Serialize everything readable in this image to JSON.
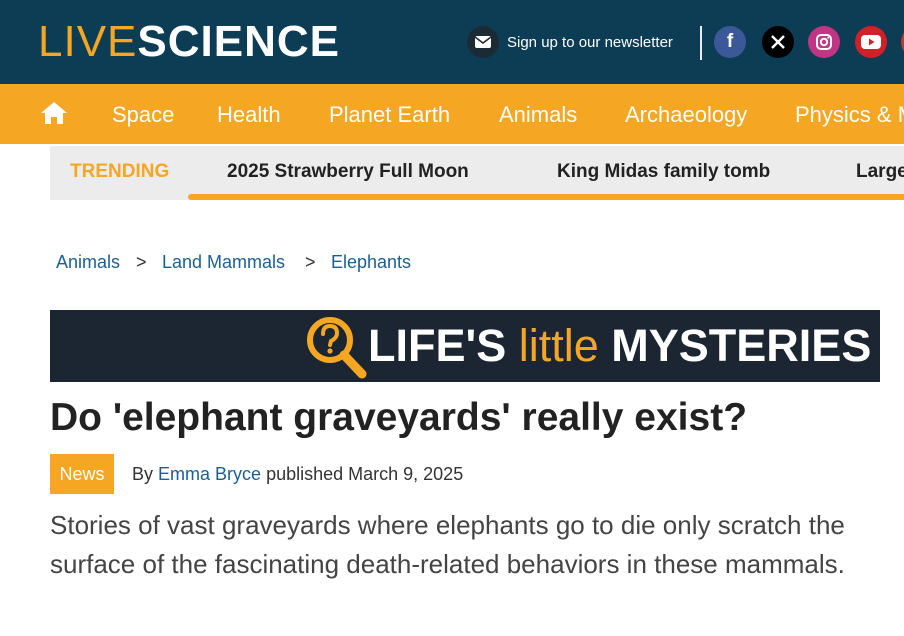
{
  "colors": {
    "topbar": "#0d3c55",
    "accent": "#f5a623",
    "link": "#1a5f96",
    "banner": "#1c2633"
  },
  "header": {
    "logo_live": "LIVE",
    "logo_science": "SCIENCE",
    "newsletter_icon": "mail-icon",
    "newsletter_text": "Sign up to our newsletter",
    "social": [
      {
        "name": "facebook-icon",
        "glyph": "f"
      },
      {
        "name": "x-icon",
        "glyph": "𝕏"
      },
      {
        "name": "instagram-icon",
        "glyph": "◎"
      },
      {
        "name": "youtube-icon",
        "glyph": "▶"
      }
    ]
  },
  "nav": {
    "home_icon": "home-icon",
    "items": [
      "Space",
      "Health",
      "Planet Earth",
      "Animals",
      "Archaeology",
      "Physics & Math"
    ]
  },
  "trending": {
    "label": "TRENDING",
    "items": [
      "2025 Strawberry Full Moon",
      "King Midas family tomb",
      "Large"
    ]
  },
  "breadcrumb": {
    "items": [
      "Animals",
      "Land Mammals",
      "Elephants"
    ],
    "separator": ">"
  },
  "banner": {
    "icon": "magnifier-question-icon",
    "part1": "LIFE'S",
    "part2": "little",
    "part3": "MYSTERIES"
  },
  "article": {
    "headline": "Do 'elephant graveyards' really exist?",
    "badge": "News",
    "by": "By",
    "author": "Emma Bryce",
    "published": "published March 9, 2025",
    "standfirst": "Stories of vast graveyards where elephants go to die only scratch the surface of the fascinating death-related behaviors in these mammals."
  }
}
